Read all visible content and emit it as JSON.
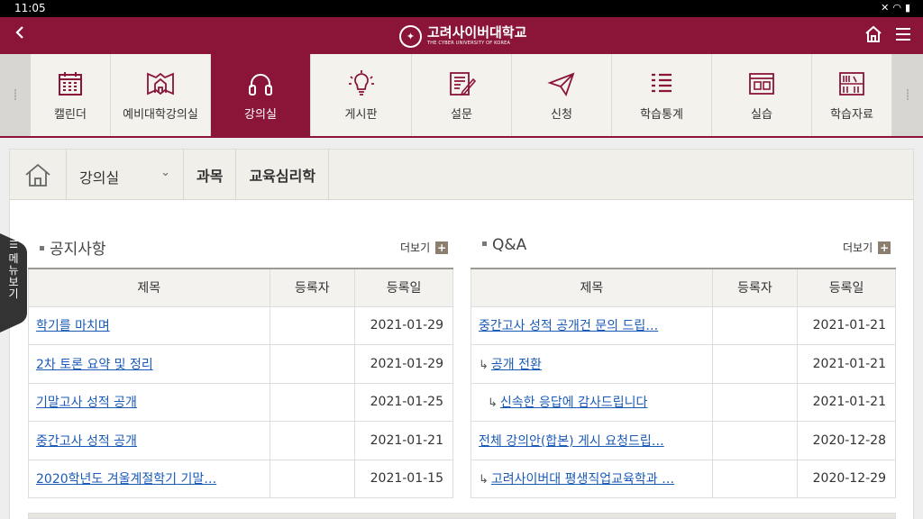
{
  "status": {
    "time": "11:05"
  },
  "header": {
    "logo_ko": "고려사이버대학교",
    "logo_en": "THE CYBER UNIVERSITY OF KOREA"
  },
  "nav": {
    "items": [
      {
        "label": "캘린더",
        "icon": "calendar-icon"
      },
      {
        "label": "예비대학강의실",
        "icon": "pre-college-icon"
      },
      {
        "label": "강의실",
        "icon": "headphones-icon"
      },
      {
        "label": "게시판",
        "icon": "lightbulb-icon"
      },
      {
        "label": "설문",
        "icon": "survey-icon"
      },
      {
        "label": "신청",
        "icon": "paper-plane-icon"
      },
      {
        "label": "학습통계",
        "icon": "list-icon"
      },
      {
        "label": "실습",
        "icon": "practice-icon"
      },
      {
        "label": "학습자료",
        "icon": "bookshelf-icon"
      }
    ],
    "active_index": 2
  },
  "breadcrumb": {
    "section": "강의실",
    "subject_label": "과목",
    "subject": "교육심리학"
  },
  "side_tab": {
    "label": "메뉴보기"
  },
  "notices": {
    "title": "공지사항",
    "more": "더보기",
    "columns": [
      "제목",
      "등록자",
      "등록일"
    ],
    "rows": [
      {
        "title": "학기를 마치며",
        "author": "",
        "date": "2021-01-29"
      },
      {
        "title": "2차 토론 요약 및 정리",
        "author": "",
        "date": "2021-01-29"
      },
      {
        "title": "기말고사 성적 공개",
        "author": "",
        "date": "2021-01-25"
      },
      {
        "title": "중간고사 성적 공개",
        "author": "",
        "date": "2021-01-21"
      },
      {
        "title": "2020학년도 겨울계절학기 기말…",
        "author": "",
        "date": "2021-01-15"
      }
    ]
  },
  "qna": {
    "title": "Q&A",
    "more": "더보기",
    "columns": [
      "제목",
      "등록자",
      "등록일"
    ],
    "rows": [
      {
        "title": "중간고사 성적 공개건 문의 드립…",
        "author": "",
        "date": "2021-01-21",
        "depth": 0
      },
      {
        "title": "공개 전환",
        "author": "",
        "date": "2021-01-21",
        "depth": 1
      },
      {
        "title": "신속한 응답에 감사드립니다",
        "author": "",
        "date": "2021-01-21",
        "depth": 2
      },
      {
        "title": "전체 강의안(합본) 게시 요청드립…",
        "author": "",
        "date": "2020-12-28",
        "depth": 0
      },
      {
        "title": "고려사이버대 평생직업교육학과 …",
        "author": "",
        "date": "2020-12-29",
        "depth": 1
      }
    ]
  }
}
